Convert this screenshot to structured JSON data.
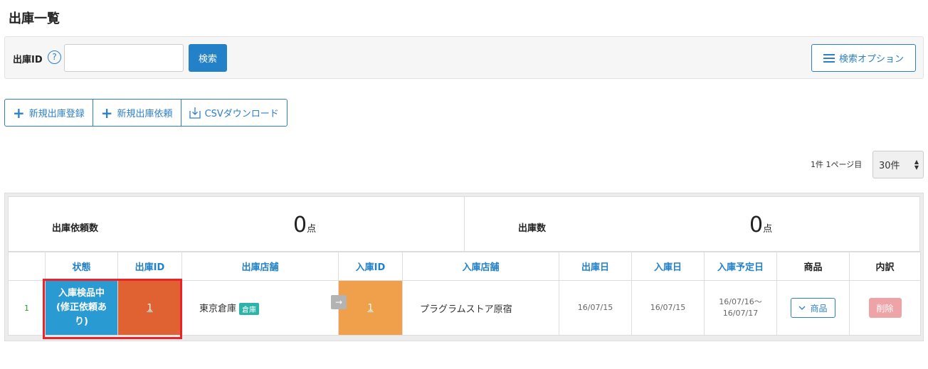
{
  "page": {
    "title": "出庫一覧"
  },
  "search": {
    "label": "出庫ID",
    "help_icon": "?",
    "input_value": "",
    "button_label": "検索",
    "options_label": "検索オプション"
  },
  "actions": {
    "new_shipment": "新規出庫登録",
    "new_request": "新規出庫依頼",
    "csv_download": "CSVダウンロード"
  },
  "pager": {
    "info": "1件 1ページ目",
    "per_page": "30件"
  },
  "summary": {
    "request_label": "出庫依頼数",
    "request_value": "0",
    "request_unit": "点",
    "shipment_label": "出庫数",
    "shipment_value": "0",
    "shipment_unit": "点"
  },
  "table": {
    "headers": [
      "状態",
      "出庫ID",
      "出庫店舗",
      "入庫ID",
      "入庫店舗",
      "出庫日",
      "入庫日",
      "入庫予定日",
      "商品",
      "内訳"
    ],
    "rows": [
      {
        "num": "1",
        "status_line1": "入庫検品中",
        "status_line2": "(修正依頼あ",
        "status_line3": "り)",
        "out_id": "1",
        "out_store": "東京倉庫",
        "out_store_badge": "倉庫",
        "arrow": "→",
        "in_id": "1",
        "in_store": "プラグラムストア原宿",
        "out_date": "16/07/15",
        "in_date": "16/07/15",
        "planned_date_line1": "16/07/16〜",
        "planned_date_line2": "16/07/17",
        "product_button": "商品",
        "delete_button": "削除"
      }
    ]
  },
  "colors": {
    "accent": "#2381c8",
    "status_bg": "#2a9ad2",
    "out_id_bg": "#e06232",
    "in_id_bg": "#f0a04a",
    "badge": "#2cb4a9",
    "delete": "#eea4a7",
    "highlight": "#e8242a"
  }
}
